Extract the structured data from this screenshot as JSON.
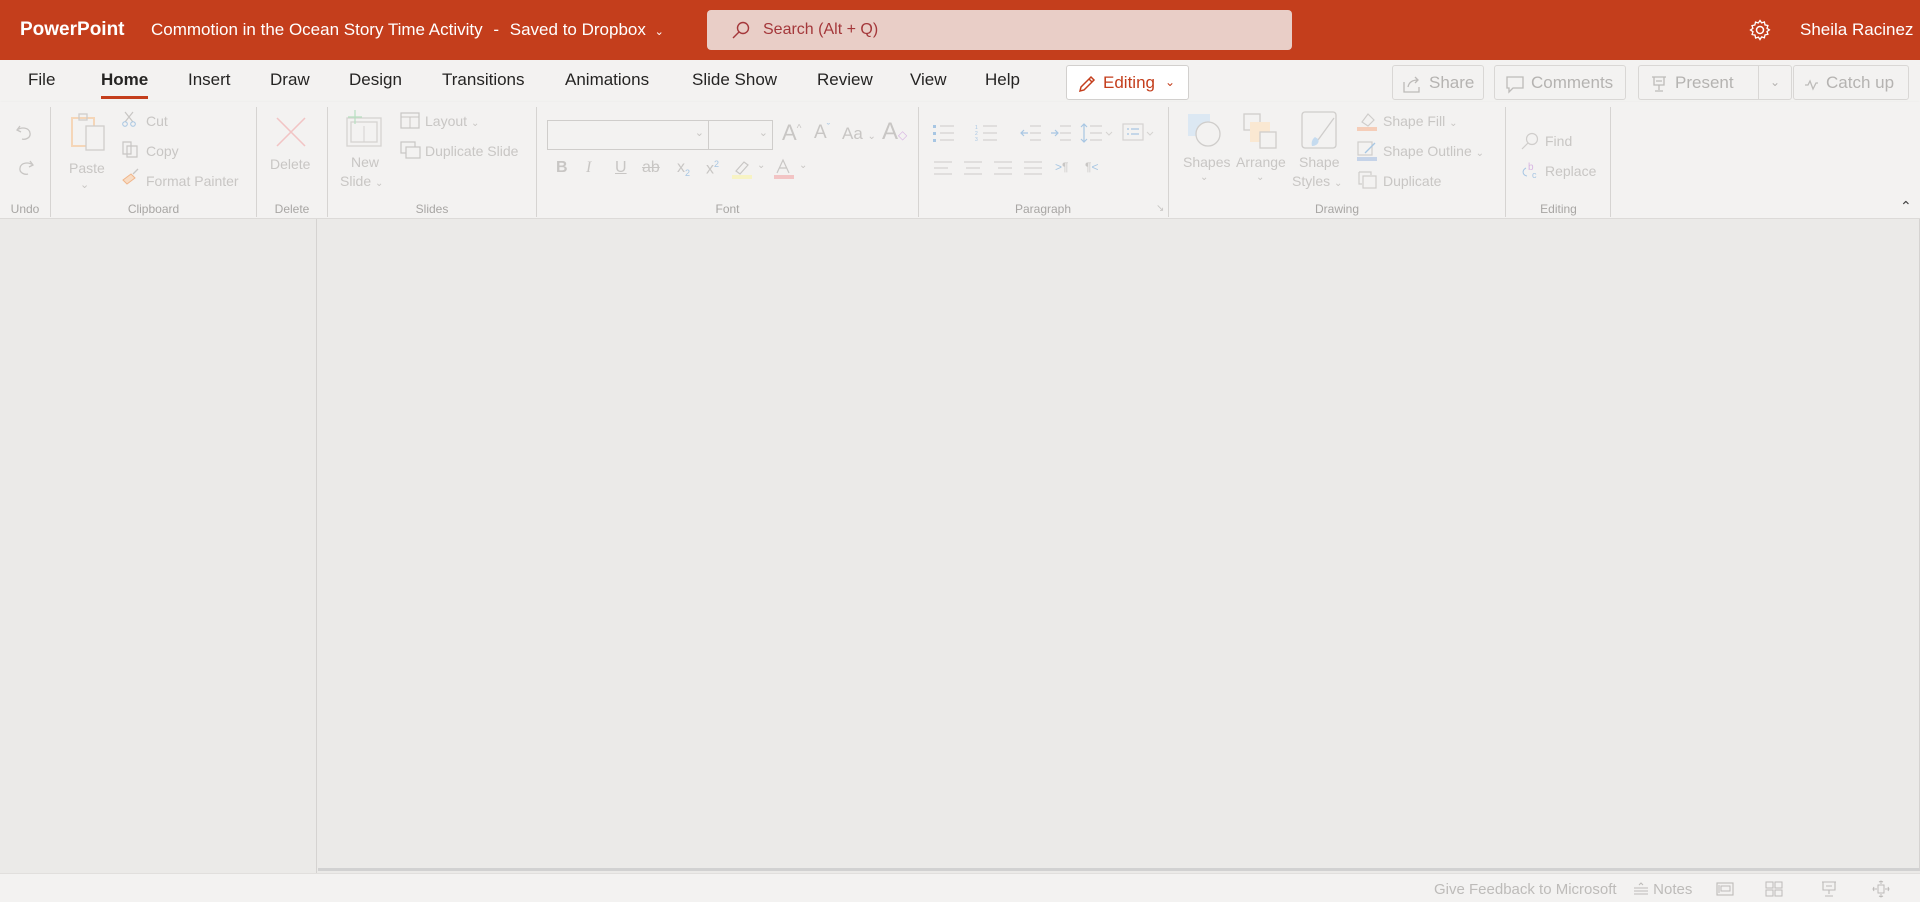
{
  "app": {
    "name": "PowerPoint",
    "document_title": "Commotion in the Ocean Story Time Activity",
    "separator": "-",
    "save_status": "Saved to Dropbox",
    "search_placeholder": "Search (Alt + Q)",
    "user_name": "Sheila Racinez",
    "accent_color": "#c43e1c"
  },
  "tabs": [
    {
      "label": "File"
    },
    {
      "label": "Home",
      "active": true
    },
    {
      "label": "Insert"
    },
    {
      "label": "Draw"
    },
    {
      "label": "Design"
    },
    {
      "label": "Transitions"
    },
    {
      "label": "Animations"
    },
    {
      "label": "Slide Show"
    },
    {
      "label": "Review"
    },
    {
      "label": "View"
    },
    {
      "label": "Help"
    }
  ],
  "mode_button": {
    "label": "Editing",
    "icon": "pencil-icon"
  },
  "actions": {
    "share": "Share",
    "comments": "Comments",
    "present": "Present",
    "catch_up": "Catch up"
  },
  "ribbon": {
    "groups": {
      "undo": "Undo",
      "clipboard": "Clipboard",
      "delete": "Delete",
      "slides": "Slides",
      "font": "Font",
      "paragraph": "Paragraph",
      "drawing": "Drawing",
      "editing": "Editing"
    },
    "clipboard": {
      "paste": "Paste",
      "cut": "Cut",
      "copy": "Copy",
      "format_painter": "Format Painter"
    },
    "delete": {
      "delete": "Delete"
    },
    "slides": {
      "new_slide_1": "New",
      "new_slide_2": "Slide",
      "layout": "Layout",
      "duplicate_slide": "Duplicate Slide"
    },
    "font": {
      "font_name": "",
      "font_size": "",
      "bold": "B",
      "italic": "I",
      "underline": "U",
      "strikethrough": "ab",
      "subscript": "x",
      "superscript": "x",
      "case": "Aa"
    },
    "drawing": {
      "shapes": "Shapes",
      "arrange": "Arrange",
      "shape_styles_1": "Shape",
      "shape_styles_2": "Styles",
      "shape_fill": "Shape Fill",
      "shape_outline": "Shape Outline",
      "duplicate": "Duplicate"
    },
    "editing": {
      "find": "Find",
      "replace": "Replace"
    }
  },
  "status_bar": {
    "feedback": "Give Feedback to Microsoft",
    "notes": "Notes"
  }
}
